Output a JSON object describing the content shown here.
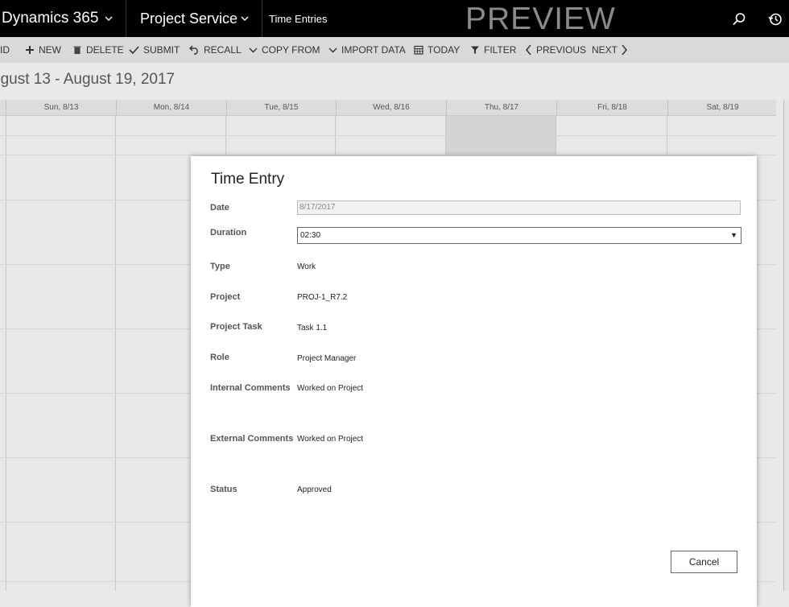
{
  "topbar": {
    "brand": "Dynamics 365",
    "area": "Project Service",
    "page": "Time Entries",
    "preview": "PREVIEW",
    "icons": [
      "chevron-down-icon",
      "search-icon",
      "history-icon"
    ]
  },
  "commands": {
    "grid": "ID",
    "new": "NEW",
    "delete": "DELETE",
    "submit": "SUBMIT",
    "recall": "RECALL",
    "copy_from": "COPY FROM",
    "import_data": "IMPORT DATA",
    "today": "TODAY",
    "filter": "FILTER",
    "previous": "PREVIOUS",
    "next": "NEXT"
  },
  "header": {
    "date_range": "ugust 13 - August 19, 2017"
  },
  "calendar": {
    "days": [
      "Sun, 8/13",
      "Mon, 8/14",
      "Tue, 8/15",
      "Wed, 8/16",
      "Thu, 8/17",
      "Fri, 8/18",
      "Sat, 8/19"
    ]
  },
  "dialog": {
    "title": "Time Entry",
    "fields": {
      "date": {
        "label": "Date",
        "value": "8/17/2017"
      },
      "duration": {
        "label": "Duration",
        "value": "02:30"
      },
      "type": {
        "label": "Type",
        "value": "Work"
      },
      "project": {
        "label": "Project",
        "value": "PROJ-1_R7.2"
      },
      "project_task": {
        "label": "Project Task",
        "value": "Task 1.1"
      },
      "role": {
        "label": "Role",
        "value": "Project Manager"
      },
      "internal_comments": {
        "label": "Internal Comments",
        "value": "Worked on Project"
      },
      "external_comments": {
        "label": "External Comments",
        "value": "Worked on Project"
      },
      "status": {
        "label": "Status",
        "value": "Approved"
      }
    },
    "cancel_label": "Cancel",
    "dropdown_arrow": "▼"
  }
}
